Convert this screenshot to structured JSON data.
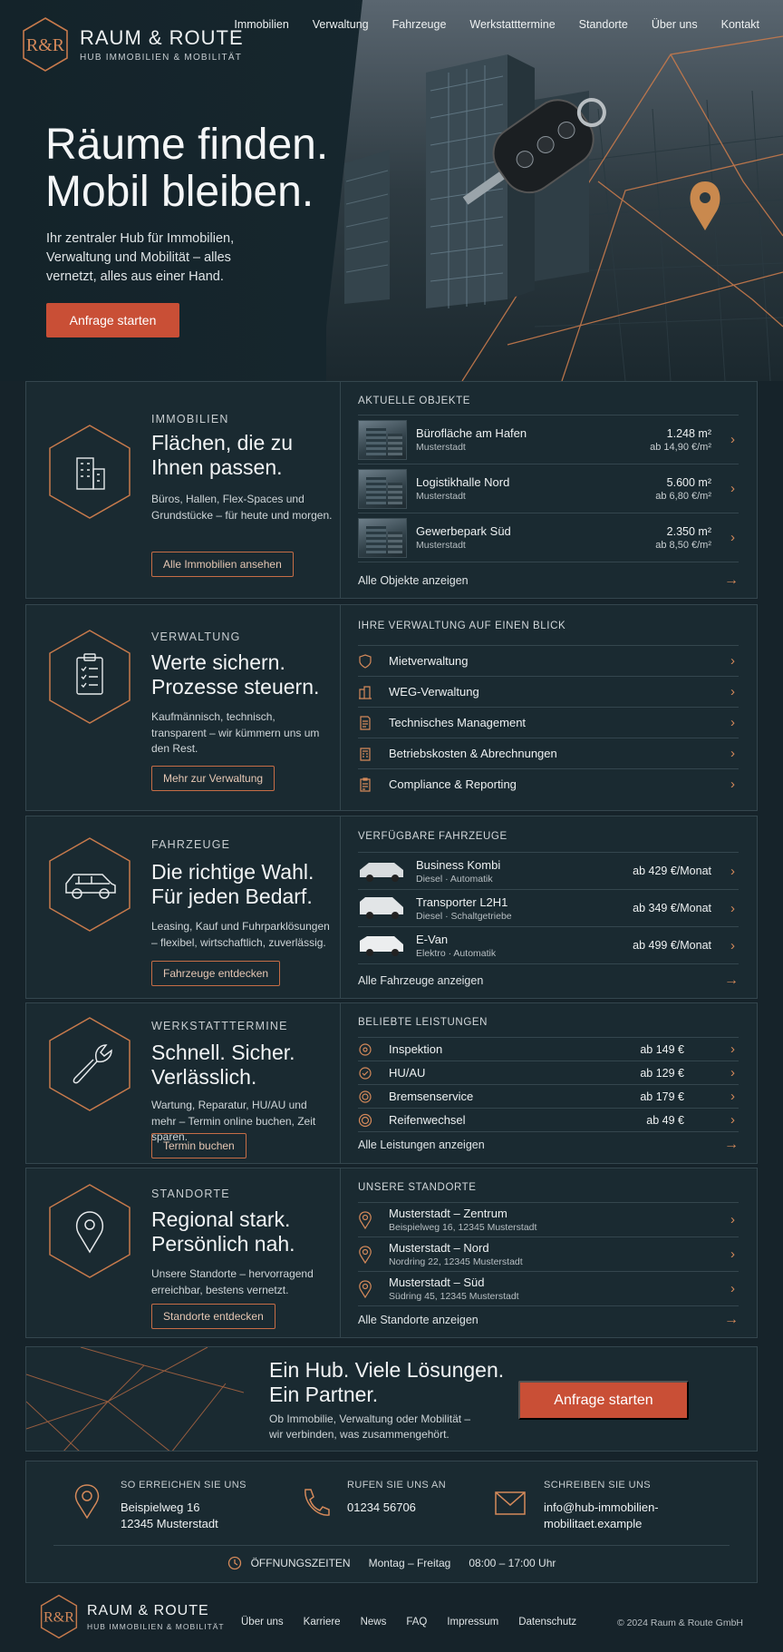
{
  "brand": {
    "name": "RAUM & ROUTE",
    "subtitle": "HUB IMMOBILIEN & MOBILITÄT",
    "mark": "R&R"
  },
  "nav": [
    "Immobilien",
    "Verwaltung",
    "Fahrzeuge",
    "Werkstatttermine",
    "Standorte",
    "Über uns",
    "Kontakt"
  ],
  "hero": {
    "title_line1": "Räume finden.",
    "title_line2": "Mobil bleiben.",
    "text": "Ihr zentraler Hub für Immobilien, Verwaltung und Mobilität – alles vernetzt, alles aus einer Hand.",
    "button": "Anfrage starten"
  },
  "immobilien": {
    "eyebrow": "IMMOBILIEN",
    "title": "Flächen, die zu Ihnen passen.",
    "text": "Büros, Hallen, Flex-Spaces und Grundstücke – für heute und morgen.",
    "button": "Alle Immobilien ansehen",
    "list_heading": "AKTUELLE OBJEKTE",
    "items": [
      {
        "title": "Bürofläche am Hafen",
        "location": "Musterstadt",
        "area": "1.248 m²",
        "price": "ab 14,90 €/m²"
      },
      {
        "title": "Logistikhalle Nord",
        "location": "Musterstadt",
        "area": "5.600 m²",
        "price": "ab 6,80 €/m²"
      },
      {
        "title": "Gewerbepark Süd",
        "location": "Musterstadt",
        "area": "2.350 m²",
        "price": "ab 8,50 €/m²"
      }
    ],
    "footer_link": "Alle Objekte anzeigen"
  },
  "verwaltung": {
    "eyebrow": "VERWALTUNG",
    "title": "Werte sichern. Prozesse steuern.",
    "text": "Kaufmännisch, technisch, transparent – wir kümmern uns um den Rest.",
    "button": "Mehr zur Verwaltung",
    "list_heading": "IHRE VERWALTUNG AUF EINEN BLICK",
    "items": [
      "Mietverwaltung",
      "WEG-Verwaltung",
      "Technisches Management",
      "Betriebskosten & Abrechnungen",
      "Compliance & Reporting"
    ]
  },
  "fahrzeuge": {
    "eyebrow": "FAHRZEUGE",
    "title": "Die richtige Wahl. Für jeden Bedarf.",
    "text": "Leasing, Kauf und Fuhrparklösungen – flexibel, wirtschaftlich, zuverlässig.",
    "button": "Fahrzeuge entdecken",
    "list_heading": "VERFÜGBARE FAHRZEUGE",
    "items": [
      {
        "title": "Business Kombi",
        "specs": "Diesel · Automatik",
        "price": "ab 429 €/Monat"
      },
      {
        "title": "Transporter L2H1",
        "specs": "Diesel · Schaltgetriebe",
        "price": "ab 349 €/Monat"
      },
      {
        "title": "E-Van",
        "specs": "Elektro · Automatik",
        "price": "ab 499 €/Monat"
      }
    ],
    "footer_link": "Alle Fahrzeuge anzeigen"
  },
  "werkstatt": {
    "eyebrow": "WERKSTATTTERMINE",
    "title": "Schnell. Sicher. Verlässlich.",
    "text": "Wartung, Reparatur, HU/AU und mehr – Termin online buchen, Zeit sparen.",
    "button": "Termin buchen",
    "list_heading": "BELIEBTE LEISTUNGEN",
    "items": [
      {
        "title": "Inspektion",
        "price": "ab 149 €"
      },
      {
        "title": "HU/AU",
        "price": "ab 129 €"
      },
      {
        "title": "Bremsenservice",
        "price": "ab 179 €"
      },
      {
        "title": "Reifenwechsel",
        "price": "ab 49 €"
      }
    ],
    "footer_link": "Alle Leistungen anzeigen"
  },
  "standorte": {
    "eyebrow": "STANDORTE",
    "title": "Regional stark. Persönlich nah.",
    "text": "Unsere Standorte – hervorragend erreichbar, bestens vernetzt.",
    "button": "Standorte entdecken",
    "list_heading": "UNSERE STANDORTE",
    "items": [
      {
        "title": "Musterstadt – Zentrum",
        "address": "Beispielweg 16, 12345 Musterstadt"
      },
      {
        "title": "Musterstadt – Nord",
        "address": "Nordring 22, 12345 Musterstadt"
      },
      {
        "title": "Musterstadt – Süd",
        "address": "Südring 45, 12345 Musterstadt"
      }
    ],
    "footer_link": "Alle Standorte anzeigen"
  },
  "cta": {
    "title_line1": "Ein Hub. Viele Lösungen.",
    "title_line2": "Ein Partner.",
    "text": "Ob Immobilie, Verwaltung oder Mobilität – wir verbinden, was zusammengehört.",
    "button": "Anfrage starten"
  },
  "contact": {
    "address_label": "SO ERREICHEN SIE UNS",
    "address_line1": "Beispielweg 16",
    "address_line2": "12345 Musterstadt",
    "phone_label": "RUFEN SIE UNS AN",
    "phone": "01234 56706",
    "mail_label": "SCHREIBEN SIE UNS",
    "mail_line1": "info@hub-immobilien-",
    "mail_line2": "mobilitaet.example",
    "hours_label": "ÖFFNUNGSZEITEN",
    "hours_days": "Montag – Freitag",
    "hours_time": "08:00 – 17:00 Uhr"
  },
  "footer": {
    "links": [
      "Über uns",
      "Karriere",
      "News",
      "FAQ",
      "Impressum",
      "Datenschutz"
    ],
    "copyright": "© 2024 Raum & Route GmbH"
  },
  "colors": {
    "accent": "#c94f36",
    "line": "#d4895a",
    "background": "#16232a",
    "panel": "#1a2a31"
  }
}
